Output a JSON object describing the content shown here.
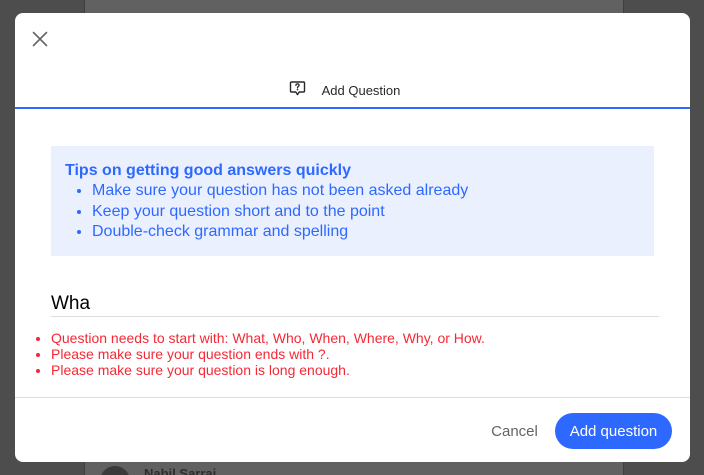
{
  "background": {
    "user_name": "Nabil Sarraj"
  },
  "modal": {
    "tab_label": "Add Question",
    "tips": {
      "title": "Tips on getting good answers quickly",
      "items": [
        "Make sure your question has not been asked already",
        "Keep your question short and to the point",
        "Double-check grammar and spelling"
      ]
    },
    "question_input": {
      "value": "Wha"
    },
    "errors": [
      "Question needs to start with: What, Who, When, Where, Why, or How.",
      "Please make sure your question ends with ?.",
      "Please make sure your question is long enough."
    ],
    "footer": {
      "cancel_label": "Cancel",
      "submit_label": "Add question"
    }
  },
  "icons": {
    "close": "close-icon",
    "tab": "question-bubble-icon"
  },
  "colors": {
    "accent": "#2e69ff",
    "tips_background": "#ebf0ff",
    "error": "#f52936"
  }
}
